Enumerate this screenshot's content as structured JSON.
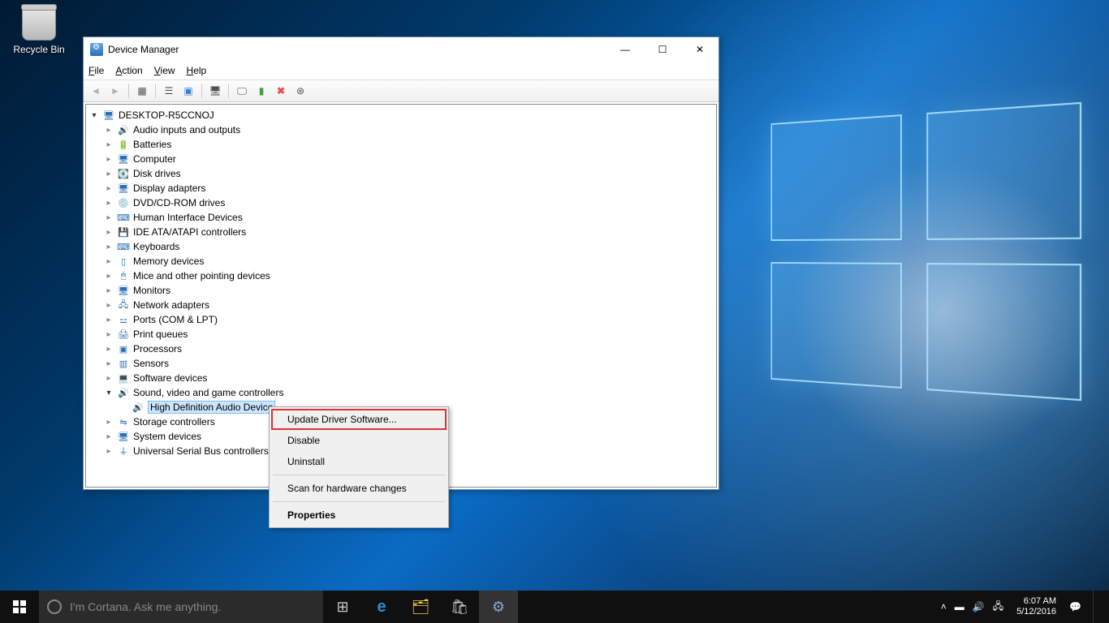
{
  "desktop": {
    "recycle_bin": "Recycle Bin"
  },
  "window": {
    "title": "Device Manager",
    "controls": {
      "min": "—",
      "max": "☐",
      "close": "✕"
    },
    "menu": [
      "File",
      "Action",
      "View",
      "Help"
    ],
    "root": "DESKTOP-R5CCNOJ",
    "categories": [
      {
        "label": "Audio inputs and outputs",
        "icon": "🔊"
      },
      {
        "label": "Batteries",
        "icon": "🔋"
      },
      {
        "label": "Computer",
        "icon": "🖥"
      },
      {
        "label": "Disk drives",
        "icon": "💽"
      },
      {
        "label": "Display adapters",
        "icon": "🖥"
      },
      {
        "label": "DVD/CD-ROM drives",
        "icon": "💿"
      },
      {
        "label": "Human Interface Devices",
        "icon": "⌨"
      },
      {
        "label": "IDE ATA/ATAPI controllers",
        "icon": "💾"
      },
      {
        "label": "Keyboards",
        "icon": "⌨"
      },
      {
        "label": "Memory devices",
        "icon": "▯"
      },
      {
        "label": "Mice and other pointing devices",
        "icon": "🖱"
      },
      {
        "label": "Monitors",
        "icon": "🖥"
      },
      {
        "label": "Network adapters",
        "icon": "🖧"
      },
      {
        "label": "Ports (COM & LPT)",
        "icon": "⚍"
      },
      {
        "label": "Print queues",
        "icon": "🖨"
      },
      {
        "label": "Processors",
        "icon": "▣"
      },
      {
        "label": "Sensors",
        "icon": "▥"
      },
      {
        "label": "Software devices",
        "icon": "💻"
      }
    ],
    "expanded_category": {
      "label": "Sound, video and game controllers",
      "icon": "🔊"
    },
    "selected_device": "High Definition Audio Device",
    "after_categories": [
      {
        "label": "Storage controllers",
        "icon": "⇋"
      },
      {
        "label": "System devices",
        "icon": "🖥"
      },
      {
        "label": "Universal Serial Bus controllers",
        "icon": "⏚"
      }
    ]
  },
  "context_menu": {
    "items": [
      {
        "label": "Update Driver Software...",
        "highlight": true
      },
      {
        "label": "Disable"
      },
      {
        "label": "Uninstall"
      },
      {
        "sep": true
      },
      {
        "label": "Scan for hardware changes"
      },
      {
        "sep": true
      },
      {
        "label": "Properties",
        "bold": true
      }
    ]
  },
  "taskbar": {
    "search_placeholder": "I'm Cortana. Ask me anything.",
    "clock_time": "6:07 AM",
    "clock_date": "5/12/2016"
  }
}
